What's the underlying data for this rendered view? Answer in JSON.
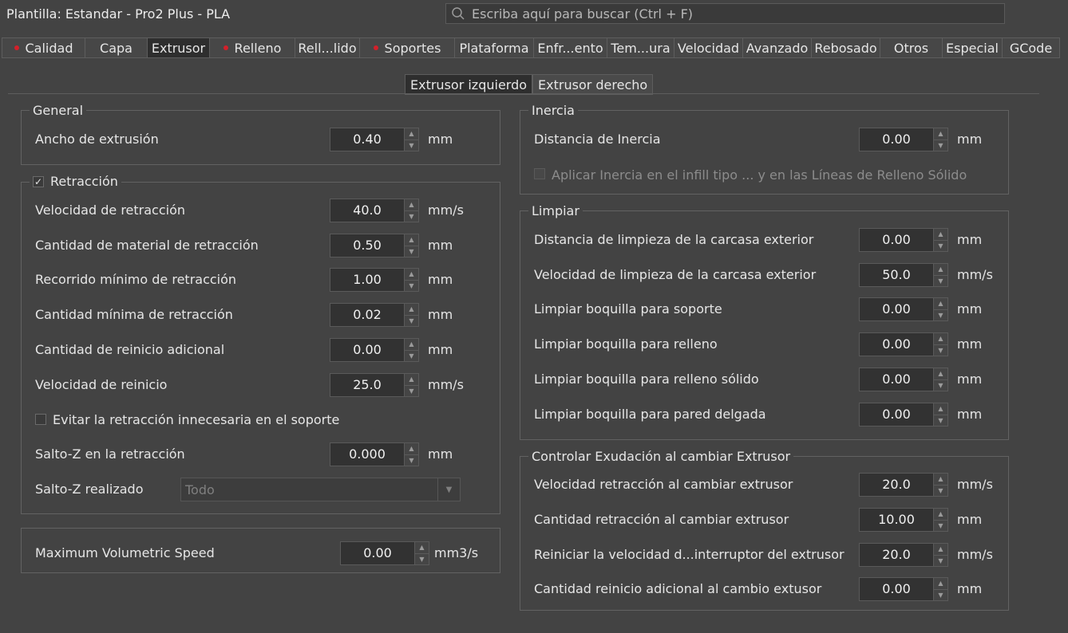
{
  "window": {
    "title": "Plantilla: Estandar - Pro2 Plus - PLA"
  },
  "search": {
    "placeholder": "Escriba aquí para buscar (Ctrl + F)"
  },
  "tabs": [
    {
      "label": "Calidad",
      "dot": true,
      "w": 104
    },
    {
      "label": "Capa",
      "dot": false,
      "w": 78
    },
    {
      "label": "Extrusor",
      "dot": false,
      "w": 78,
      "active": true
    },
    {
      "label": "Relleno",
      "dot": true,
      "w": 107
    },
    {
      "label": "Rell...lido",
      "dot": false,
      "w": 81
    },
    {
      "label": "Soportes",
      "dot": true,
      "w": 119
    },
    {
      "label": "Plataforma",
      "dot": false,
      "w": 99
    },
    {
      "label": "Enfr...ento",
      "dot": false,
      "w": 92
    },
    {
      "label": "Tem...ura",
      "dot": false,
      "w": 84
    },
    {
      "label": "Velocidad",
      "dot": false,
      "w": 86
    },
    {
      "label": "Avanzado",
      "dot": false,
      "w": 86
    },
    {
      "label": "Rebosado",
      "dot": false,
      "w": 86
    },
    {
      "label": "Otros",
      "dot": false,
      "w": 78
    },
    {
      "label": "Especial",
      "dot": false,
      "w": 75
    },
    {
      "label": "GCode",
      "dot": false,
      "w": 73
    }
  ],
  "subtabs": {
    "left": "Extrusor izquierdo",
    "right": "Extrusor derecho"
  },
  "general": {
    "title": "General",
    "ancho": {
      "label": "Ancho de extrusión",
      "value": "0.40",
      "unit": "mm"
    }
  },
  "retraccion": {
    "title": "Retracción",
    "enabled": true,
    "velocidad": {
      "label": "Velocidad de retracción",
      "value": "40.0",
      "unit": "mm/s"
    },
    "cantidad": {
      "label": "Cantidad de material de retracción",
      "value": "0.50",
      "unit": "mm"
    },
    "recorrido": {
      "label": "Recorrido mínimo de retracción",
      "value": "1.00",
      "unit": "mm"
    },
    "minima": {
      "label": "Cantidad mínima de retracción",
      "value": "0.02",
      "unit": "mm"
    },
    "reinicio_adicional": {
      "label": "Cantidad de reinicio adicional",
      "value": "0.00",
      "unit": "mm"
    },
    "velocidad_reinicio": {
      "label": "Velocidad de reinicio",
      "value": "25.0",
      "unit": "mm/s"
    },
    "evitar": {
      "label": "Evitar la retracción innecesaria en el soporte",
      "checked": false
    },
    "salto_z": {
      "label": "Salto-Z en la retracción",
      "value": "0.000",
      "unit": "mm"
    },
    "salto_realizado": {
      "label": "Salto-Z realizado",
      "value": "Todo"
    }
  },
  "volumetric": {
    "label": "Maximum Volumetric Speed",
    "value": "0.00",
    "unit": "mm3/s"
  },
  "inercia": {
    "title": "Inercia",
    "distancia": {
      "label": "Distancia de Inercia",
      "value": "0.00",
      "unit": "mm"
    },
    "aplicar": {
      "label": "Aplicar Inercia en el infill tipo ... y en las Líneas de Relleno Sólido",
      "checked": false
    }
  },
  "limpiar": {
    "title": "Limpiar",
    "distancia": {
      "label": "Distancia de limpieza de la carcasa exterior",
      "value": "0.00",
      "unit": "mm"
    },
    "velocidad": {
      "label": "Velocidad de limpieza de la carcasa exterior",
      "value": "50.0",
      "unit": "mm/s"
    },
    "soporte": {
      "label": "Limpiar boquilla para soporte",
      "value": "0.00",
      "unit": "mm"
    },
    "relleno": {
      "label": "Limpiar boquilla para relleno",
      "value": "0.00",
      "unit": "mm"
    },
    "solido": {
      "label": "Limpiar boquilla para relleno sólido",
      "value": "0.00",
      "unit": "mm"
    },
    "pared": {
      "label": "Limpiar boquilla para pared delgada",
      "value": "0.00",
      "unit": "mm"
    }
  },
  "exudacion": {
    "title": "Controlar Exudación al cambiar Extrusor",
    "velocidad": {
      "label": "Velocidad retracción al cambiar extrusor",
      "value": "20.0",
      "unit": "mm/s"
    },
    "cantidad": {
      "label": "Cantidad retracción al cambiar extrusor",
      "value": "10.00",
      "unit": "mm"
    },
    "reiniciar": {
      "label": "Reiniciar la velocidad d...interruptor del extrusor",
      "value": "20.0",
      "unit": "mm/s"
    },
    "adicional": {
      "label": "Cantidad reinicio adicional al cambio extusor",
      "value": "0.00",
      "unit": "mm"
    }
  },
  "colors": {
    "background": "#434343",
    "active_tab": "#2e2e2e",
    "dot": "#d3202a"
  },
  "icons": {
    "search": "search-icon",
    "spin_up": "arrow-up-icon",
    "spin_down": "arrow-down-icon",
    "dropdown": "chevron-down-icon"
  }
}
